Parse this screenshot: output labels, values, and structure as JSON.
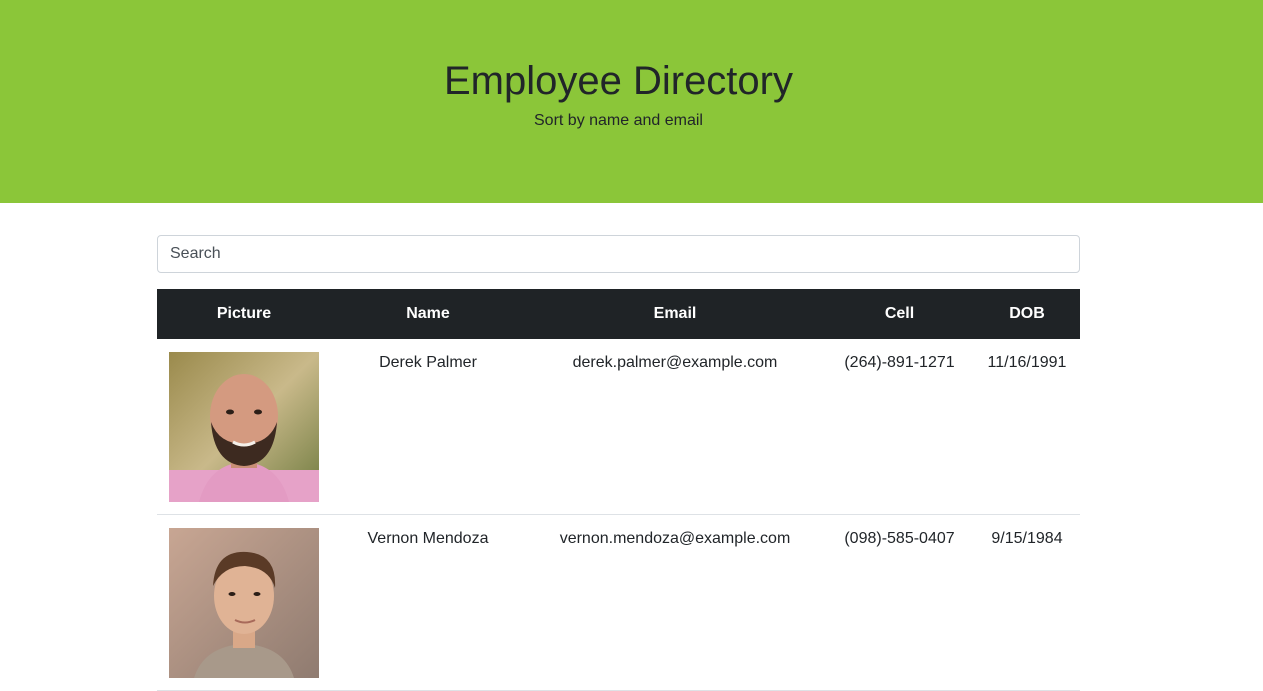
{
  "header": {
    "title": "Employee Directory",
    "subtitle": "Sort by name and email",
    "background_color": "#8bc639"
  },
  "search": {
    "placeholder": "Search",
    "value": ""
  },
  "table": {
    "header_background": "#1f2326",
    "columns": [
      "Picture",
      "Name",
      "Email",
      "Cell",
      "DOB"
    ],
    "rows": [
      {
        "picture_icon": "employee-photo",
        "name": "Derek Palmer",
        "email": "derek.palmer@example.com",
        "cell": "(264)-891-1271",
        "dob": "11/16/1991"
      },
      {
        "picture_icon": "employee-photo",
        "name": "Vernon Mendoza",
        "email": "vernon.mendoza@example.com",
        "cell": "(098)-585-0407",
        "dob": "9/15/1984"
      }
    ]
  }
}
